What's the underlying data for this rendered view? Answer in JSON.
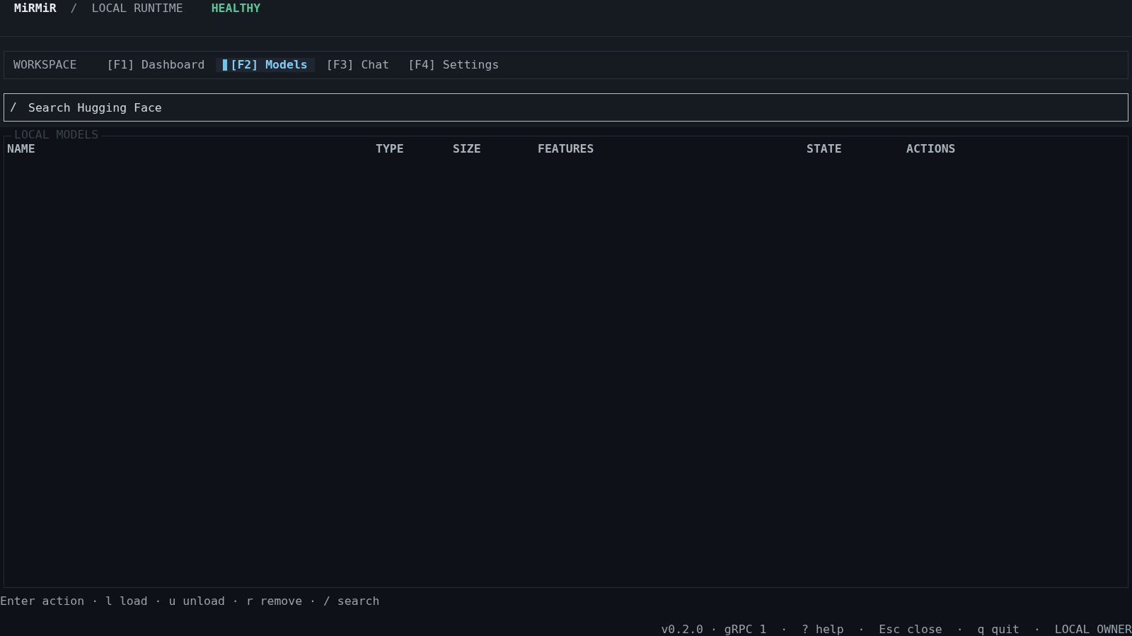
{
  "header": {
    "brand": "MiRMiR",
    "separator": "/",
    "subtitle": "LOCAL RUNTIME",
    "status": "HEALTHY"
  },
  "nav": {
    "label": "WORKSPACE",
    "tabs": [
      {
        "label": "[F1] Dashboard",
        "selected": false
      },
      {
        "label": "[F2] Models",
        "selected": true
      },
      {
        "label": "[F3] Chat",
        "selected": false
      },
      {
        "label": "[F4] Settings",
        "selected": false
      }
    ]
  },
  "search": {
    "prefix": "/",
    "placeholder": "Search Hugging Face"
  },
  "local_models": {
    "title": "LOCAL MODELS",
    "columns": [
      "NAME",
      "TYPE",
      "SIZE",
      "FEATURES",
      "STATE",
      "ACTIONS"
    ]
  },
  "hint_bar": "Enter action · l load · u unload · r remove · / search",
  "status_bar": "v0.2.0 · gRPC 1  ·  ? help  ·  Esc close  ·  q quit  ·  LOCAL OWNER"
}
